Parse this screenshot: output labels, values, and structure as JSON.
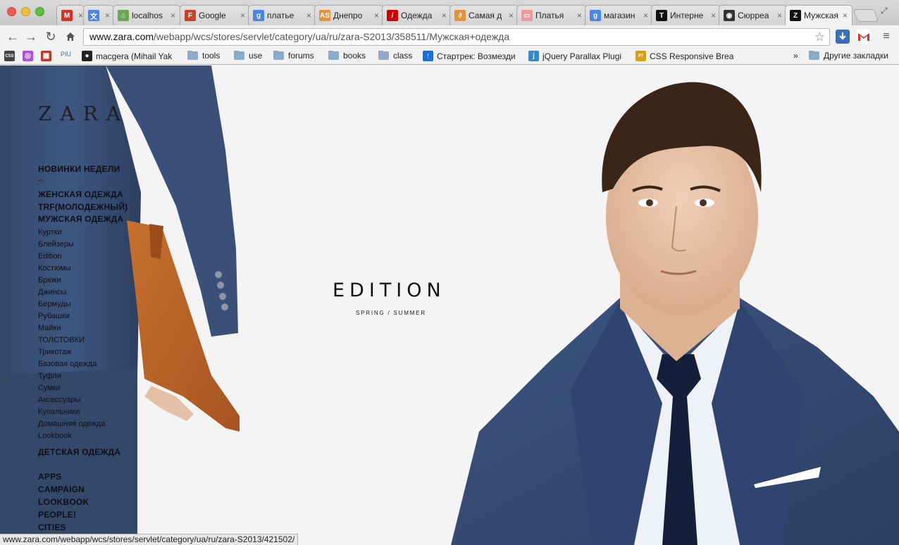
{
  "browser": {
    "tabs": [
      {
        "title": "",
        "icon": "gmail-icon",
        "color": "#d93025",
        "glyph": "M"
      },
      {
        "title": "",
        "icon": "translate-icon",
        "color": "#4a86e8",
        "glyph": "文"
      },
      {
        "title": "localhos",
        "icon": "localhost-icon",
        "color": "#6aa84f",
        "glyph": "⌂"
      },
      {
        "title": "Google",
        "icon": "google-docs-icon",
        "color": "#cc4125",
        "glyph": "F"
      },
      {
        "title": "платье",
        "icon": "google-search-icon",
        "color": "#4a86e8",
        "glyph": "g"
      },
      {
        "title": "Днепро",
        "icon": "as-icon",
        "color": "#e69138",
        "glyph": "AS"
      },
      {
        "title": "Одежда",
        "icon": "slash-icon",
        "color": "#cc0000",
        "glyph": "/"
      },
      {
        "title": "Самая д",
        "icon": "link-icon",
        "color": "#e69138",
        "glyph": "∂"
      },
      {
        "title": "Платья",
        "icon": "dress-icon",
        "color": "#ea9999",
        "glyph": "▭"
      },
      {
        "title": "магазин",
        "icon": "google-search-icon",
        "color": "#4a86e8",
        "glyph": "g"
      },
      {
        "title": "Интерне",
        "icon": "t-icon",
        "color": "#111111",
        "glyph": "T"
      },
      {
        "title": "Сюрреа",
        "icon": "camera-icon",
        "color": "#333333",
        "glyph": "◉"
      },
      {
        "title": "Мужская",
        "icon": "zara-icon",
        "color": "#111111",
        "glyph": "Z"
      }
    ],
    "url_host": "www.zara.com",
    "url_path": "/webapp/wcs/stores/servlet/category/ua/ru/zara-S2013/358511/Мужская+одежда",
    "bookmarks": [
      {
        "label": "",
        "icon": "css-icon",
        "type": "icon",
        "color": "#444",
        "glyph": "CSS"
      },
      {
        "label": "",
        "icon": "color-wheel-icon",
        "type": "icon",
        "color": "#b04fd8",
        "glyph": "◎"
      },
      {
        "label": "",
        "icon": "grid-icon",
        "type": "icon",
        "color": "#c0392b",
        "glyph": "▦"
      },
      {
        "label": "PIU",
        "icon": "piu-icon",
        "type": "text"
      },
      {
        "label": "macgera (Mihail Yak",
        "icon": "github-icon",
        "type": "icon",
        "color": "#222",
        "glyph": "●"
      },
      {
        "label": "tools",
        "icon": "folder-icon",
        "type": "folder"
      },
      {
        "label": "use",
        "icon": "folder-icon",
        "type": "folder"
      },
      {
        "label": "forums",
        "icon": "folder-icon",
        "type": "folder"
      },
      {
        "label": "books",
        "icon": "folder-icon",
        "type": "folder"
      },
      {
        "label": "class",
        "icon": "folder-icon",
        "type": "folder"
      },
      {
        "label": "Стартрек: Возмезди",
        "icon": "arrow-up-icon",
        "type": "icon",
        "color": "#1e6fd1",
        "glyph": "↑"
      },
      {
        "label": "jQuery Parallax Plugi",
        "icon": "jquery-icon",
        "type": "icon",
        "color": "#3a87c8",
        "glyph": "j"
      },
      {
        "label": "CSS Responsive Brea",
        "icon": "p7-icon",
        "type": "icon",
        "color": "#d4a017",
        "glyph": "P7"
      }
    ],
    "bookmarks_more": "»",
    "other_bookmarks": "Другие закладки",
    "status_url": "www.zara.com/webapp/wcs/stores/servlet/category/ua/ru/zara-S2013/421502/"
  },
  "site": {
    "logo": "ZARA",
    "nav": [
      {
        "label": "НОВИНКИ НЕДЕЛИ",
        "big": true
      },
      {
        "label": "–",
        "big": false
      },
      {
        "label": "ЖЕНСКАЯ ОДЕЖДА",
        "big": true
      },
      {
        "label": "TRF(МОЛОДЕЖНЫЙ)",
        "big": true
      },
      {
        "label": "МУЖСКАЯ ОДЕЖДА",
        "big": true
      },
      {
        "label": "Куртки",
        "big": false
      },
      {
        "label": "Блейзеры",
        "big": false
      },
      {
        "label": "Edition",
        "big": false
      },
      {
        "label": "Костюмы",
        "big": false
      },
      {
        "label": "Брюки",
        "big": false
      },
      {
        "label": "Джинсы",
        "big": false
      },
      {
        "label": "Бермуды",
        "big": false
      },
      {
        "label": "Рубашки",
        "big": false
      },
      {
        "label": "Майки",
        "big": false
      },
      {
        "label": "ТОЛСТОВКИ",
        "big": false
      },
      {
        "label": "Трикотаж",
        "big": false
      },
      {
        "label": "Базовая одежда",
        "big": false
      },
      {
        "label": "Туфли",
        "big": false
      },
      {
        "label": "Сумки",
        "big": false
      },
      {
        "label": "Аксессуары",
        "big": false
      },
      {
        "label": "Купальники",
        "big": false
      },
      {
        "label": "Домашняя одежда",
        "big": false
      },
      {
        "label": "Lookbook",
        "big": false
      },
      {
        "label": "ДЕТСКАЯ ОДЕЖДА",
        "big": true
      },
      {
        "label": "APPS",
        "big": true
      },
      {
        "label": "CAMPAIGN",
        "big": true
      },
      {
        "label": "LOOKBOOK",
        "big": true
      },
      {
        "label": "PEOPLE!",
        "big": true
      },
      {
        "label": "CITIES",
        "big": true
      }
    ],
    "hero_title": "EDITION",
    "hero_subtitle": "SPRING / SUMMER"
  }
}
